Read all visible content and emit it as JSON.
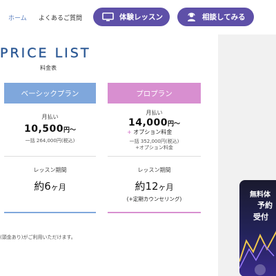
{
  "nav": {
    "home": "ホーム",
    "faq": "よくあるご質問",
    "trial_button": "体験レッスン",
    "consult_button": "相談してみる"
  },
  "price_list": {
    "title": "PRICE LIST",
    "subtitle": "料金表"
  },
  "plans": {
    "basic": {
      "name": "ベーシックプラン",
      "monthly_label": "月払い",
      "price": "10,500",
      "unit": "円〜",
      "lump": "一括 264,000円(税込)",
      "period_label": "レッスン期間",
      "period_prefix": "約",
      "period_num": "6",
      "period_suffix": "ヶ月"
    },
    "pro": {
      "name": "プロプラン",
      "monthly_label": "月払い",
      "price": "14,000",
      "unit": "円〜",
      "option_plus": "+",
      "option": "オプション料金",
      "lump": "一括 352,000円(税込)",
      "lump_option": "+オプション料金",
      "period_label": "レッスン期間",
      "period_prefix": "約",
      "period_num": "12",
      "period_suffix": "ヶ月",
      "period_note": "(+定期カウンセリング)"
    }
  },
  "footnote": "(頭金あり)がご利用いただけます。",
  "banner": {
    "line1": "無料体",
    "line2": "予約",
    "line3": "受付"
  },
  "colors": {
    "accent_button": "#5e50a8",
    "basic_header": "#7fa7dc",
    "pro_header": "#d88fd0",
    "title": "#2f5b96"
  }
}
